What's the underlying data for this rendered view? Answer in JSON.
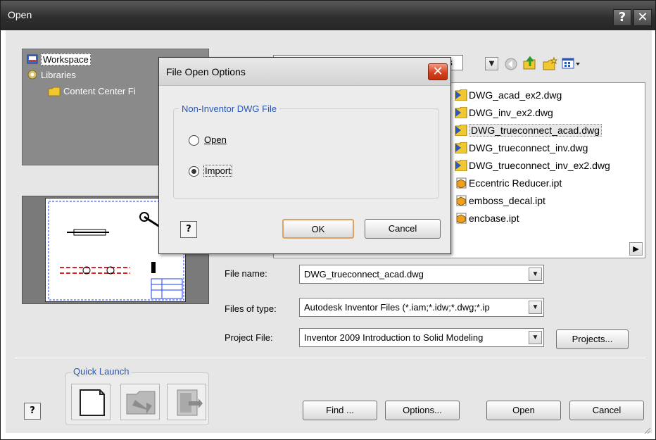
{
  "window": {
    "title": "Open",
    "help_button": "?",
    "close_button": "✕"
  },
  "tree": {
    "items": [
      {
        "label": "Workspace",
        "icon": "workspace-icon"
      },
      {
        "label": "Libraries",
        "icon": "libraries-icon"
      },
      {
        "label": "Content Center Fi",
        "icon": "folder-icon"
      }
    ]
  },
  "lookin": {
    "value": "es"
  },
  "files": [
    {
      "name": "DWG_acad_ex2.dwg",
      "icon": "dwg-file-icon"
    },
    {
      "name": "DWG_inv_ex2.dwg",
      "icon": "dwg-file-icon"
    },
    {
      "name": "DWG_trueconnect_acad.dwg",
      "icon": "dwg-file-icon"
    },
    {
      "name": "DWG_trueconnect_inv.dwg",
      "icon": "dwg-file-icon"
    },
    {
      "name": "DWG_trueconnect_inv_ex2.dwg",
      "icon": "dwg-file-icon"
    },
    {
      "name": "Eccentric Reducer.ipt",
      "icon": "part-file-icon"
    },
    {
      "name": "emboss_decal.ipt",
      "icon": "part-file-icon"
    },
    {
      "name": "encbase.ipt",
      "icon": "part-file-icon"
    }
  ],
  "form": {
    "file_name_label": "File name:",
    "file_name_value": "DWG_trueconnect_acad.dwg",
    "files_of_type_label": "Files of type:",
    "files_of_type_value": "Autodesk Inventor Files (*.iam;*.idw;*.dwg;*.ip",
    "project_file_label": "Project File:",
    "project_file_value": "Inventor 2009 Introduction to Solid Modeling",
    "projects_button": "Projects..."
  },
  "quick_launch": {
    "title": "Quick Launch"
  },
  "bottom_buttons": {
    "find": "Find ...",
    "options": "Options...",
    "open": "Open",
    "cancel": "Cancel"
  },
  "modal": {
    "title": "File Open Options",
    "group_title": "Non-Inventor DWG File",
    "option_open": "Open",
    "option_import": "Import",
    "selected": "Import",
    "ok": "OK",
    "cancel": "Cancel"
  },
  "colors": {
    "titlebar": "#2f2f2f",
    "accent_blue": "#2a57b8",
    "close_red": "#d6421d"
  }
}
